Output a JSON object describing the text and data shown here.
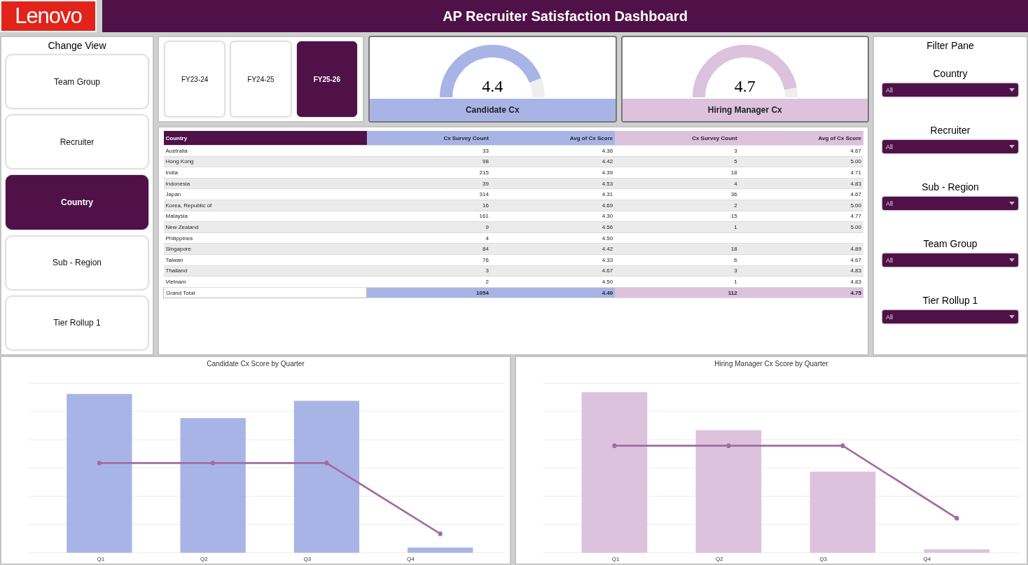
{
  "header": {
    "logo": "Lenovo",
    "title": "AP Recruiter Satisfaction Dashboard"
  },
  "change_view": {
    "title": "Change View",
    "items": [
      {
        "label": "Team Group",
        "selected": false
      },
      {
        "label": "Recruiter",
        "selected": false
      },
      {
        "label": "Country",
        "selected": true
      },
      {
        "label": "Sub - Region",
        "selected": false
      },
      {
        "label": "Tier Rollup 1",
        "selected": false
      }
    ]
  },
  "fiscal_years": [
    {
      "label": "FY23-24",
      "selected": false
    },
    {
      "label": "FY24-25",
      "selected": false
    },
    {
      "label": "FY25-26",
      "selected": true
    }
  ],
  "gauges": [
    {
      "value": "4.4",
      "label": "Candidate Cx",
      "color": "#a9b4e6"
    },
    {
      "value": "4.7",
      "label": "Hiring Manager Cx",
      "color": "#dcc2dc"
    }
  ],
  "table": {
    "columns": [
      "Country",
      "Cx Survey Count",
      "Avg of Cx Score",
      "Cx Survey Count",
      "Avg of Cx Score"
    ],
    "rows": [
      [
        "Australia",
        "33",
        "4.36",
        "3",
        "4.67"
      ],
      [
        "Hong Kong",
        "98",
        "4.42",
        "5",
        "5.00"
      ],
      [
        "India",
        "215",
        "4.39",
        "18",
        "4.71"
      ],
      [
        "Indonesia",
        "39",
        "4.53",
        "4",
        "4.83"
      ],
      [
        "Japan",
        "314",
        "4.31",
        "36",
        "4.67"
      ],
      [
        "Korea, Republic of",
        "16",
        "4.69",
        "2",
        "5.00"
      ],
      [
        "Malaysia",
        "161",
        "4.30",
        "15",
        "4.77"
      ],
      [
        "New Zealand",
        "9",
        "4.56",
        "1",
        "5.00"
      ],
      [
        "Philippines",
        "4",
        "4.50",
        null,
        null
      ],
      [
        "Singapore",
        "84",
        "4.42",
        "18",
        "4.89"
      ],
      [
        "Taiwan",
        "76",
        "4.33",
        "6",
        "4.67"
      ],
      [
        "Thailand",
        "3",
        "4.67",
        "3",
        "4.83"
      ],
      [
        "Vietnam",
        "2",
        "4.50",
        "1",
        "4.83"
      ]
    ],
    "total": [
      "Grand Total",
      "1054",
      "4.40",
      "112",
      "4.75"
    ]
  },
  "filter_pane": {
    "title": "Filter Pane",
    "filters": [
      {
        "label": "Country",
        "value": "All"
      },
      {
        "label": "Recruiter",
        "value": "All"
      },
      {
        "label": "Sub - Region",
        "value": "All"
      },
      {
        "label": "Team Group",
        "value": "All"
      },
      {
        "label": "Tier Rollup 1",
        "value": "All"
      }
    ]
  },
  "charts": [
    {
      "title": "Candidate Cx Score by Quarter",
      "quarters": [
        "Q1",
        "Q2",
        "Q3",
        "Q4"
      ],
      "color": "#a9b4e6"
    },
    {
      "title": "Hiring Manager Cx Score by Quarter",
      "quarters": [
        "Q1",
        "Q2",
        "Q3",
        "Q4"
      ],
      "color": "#dcc2dc"
    }
  ]
}
